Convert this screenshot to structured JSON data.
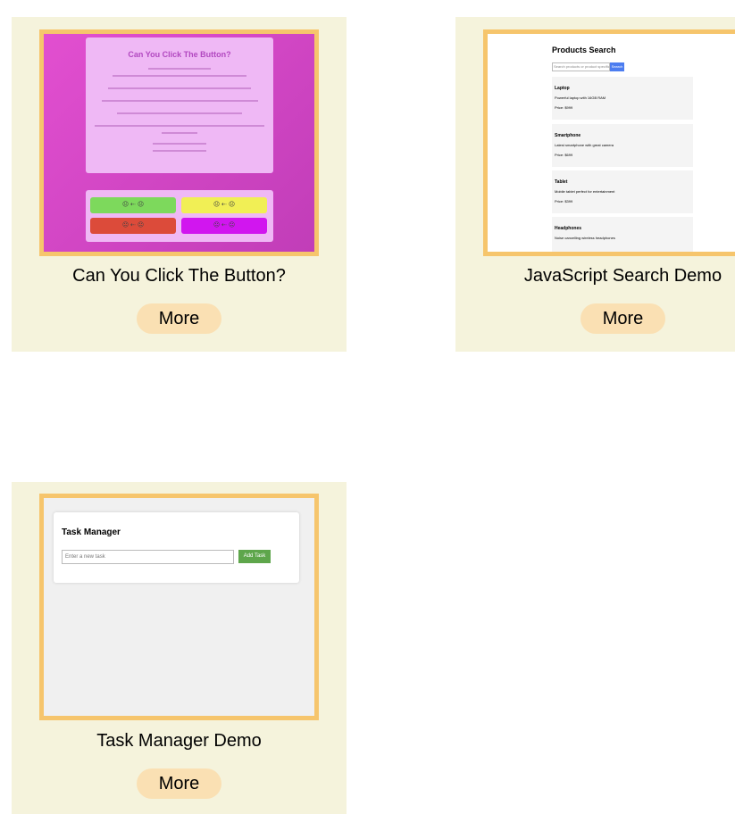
{
  "cards": [
    {
      "title": "Can You Click The Button?",
      "more_label": "More",
      "thumbnail": {
        "heading": "Can You Click The Button?",
        "buttons": [
          "☹ ⇠ ☹",
          "☹ ⇠ ☹",
          "☹ ⇠ ☹",
          "☹ ⇠ ☹"
        ]
      }
    },
    {
      "title": "JavaScript Search Demo",
      "more_label": "More",
      "thumbnail": {
        "heading": "Products Search",
        "search_placeholder": "Search products or product specification...",
        "search_button": "Search",
        "products": [
          {
            "name": "Laptop",
            "desc": "Powerful laptop with 16GB RAM",
            "price": "Price: $999"
          },
          {
            "name": "Smartphone",
            "desc": "Latest smartphone with great camera",
            "price": "Price: $699"
          },
          {
            "name": "Tablet",
            "desc": "Mobile tablet perfect for entertainment",
            "price": "Price: $399"
          },
          {
            "name": "Headphones",
            "desc": "Noise cancelling wireless headphones",
            "price": ""
          }
        ]
      }
    },
    {
      "title": "Task Manager Demo",
      "more_label": "More",
      "thumbnail": {
        "heading": "Task Manager",
        "input_placeholder": "Enter a new task",
        "add_button": "Add Task"
      }
    }
  ],
  "colors": {
    "card_bg": "#f5f3dc",
    "thumb_border": "#f6c56c",
    "more_button_bg": "#fae0b3"
  }
}
